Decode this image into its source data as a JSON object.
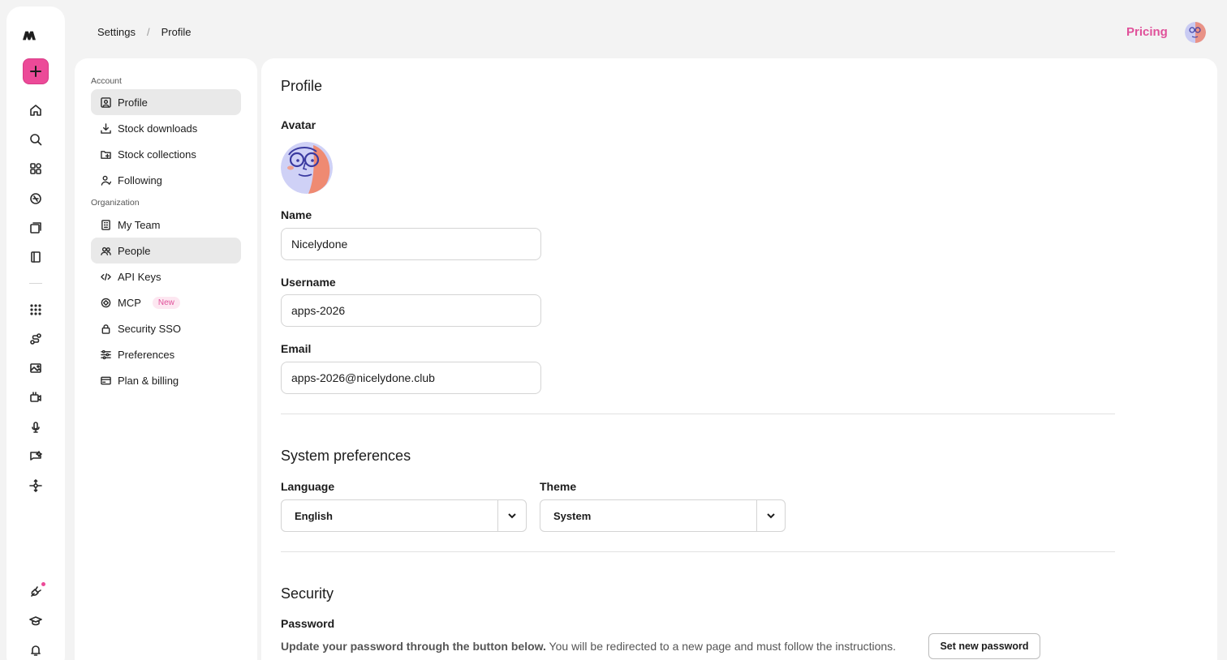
{
  "rail": {
    "icons": [
      "logo-icon",
      "plus-icon",
      "home-icon",
      "search-icon",
      "apps-grid-icon",
      "explore-icon",
      "library-icon",
      "book-icon",
      "dots-grid-icon",
      "workflow-icon",
      "image-icon",
      "video-icon",
      "microphone-icon",
      "chat-icon",
      "move-icon",
      "plug-icon",
      "graduation-cap-icon",
      "bell-icon"
    ],
    "accent": "#ec4a98"
  },
  "breadcrumb": {
    "parent": "Settings",
    "separator": "/",
    "current": "Profile"
  },
  "header": {
    "pricing_label": "Pricing",
    "pricing_color": "#e0519a"
  },
  "nav": {
    "account_group": "Account",
    "organization_group": "Organization",
    "account_items": [
      {
        "label": "Profile",
        "icon": "profile-icon",
        "active": true
      },
      {
        "label": "Stock downloads",
        "icon": "download-icon"
      },
      {
        "label": "Stock collections",
        "icon": "folder-icon"
      },
      {
        "label": "Following",
        "icon": "user-follow-icon"
      }
    ],
    "organization_items": [
      {
        "label": "My Team",
        "icon": "building-icon"
      },
      {
        "label": "People",
        "icon": "people-icon",
        "active": true
      },
      {
        "label": "API Keys",
        "icon": "code-icon"
      },
      {
        "label": "MCP",
        "icon": "mcp-icon",
        "badge": "New"
      },
      {
        "label": "Security SSO",
        "icon": "lock-icon"
      },
      {
        "label": "Preferences",
        "icon": "sliders-icon"
      },
      {
        "label": "Plan & billing",
        "icon": "card-icon"
      }
    ]
  },
  "profile": {
    "title": "Profile",
    "avatar_label": "Avatar",
    "name_label": "Name",
    "name_value": "Nicelydone",
    "username_label": "Username",
    "username_value": "apps-2026",
    "email_label": "Email",
    "email_value": "apps-2026@nicelydone.club"
  },
  "system": {
    "title": "System preferences",
    "language_label": "Language",
    "language_value": "English",
    "theme_label": "Theme",
    "theme_value": "System"
  },
  "security": {
    "title": "Security",
    "password_label": "Password",
    "password_text_bold": "Update your password through the button below.",
    "password_text": " You will be redirected to a new page and must follow the instructions.",
    "set_password_button": "Set new password"
  }
}
